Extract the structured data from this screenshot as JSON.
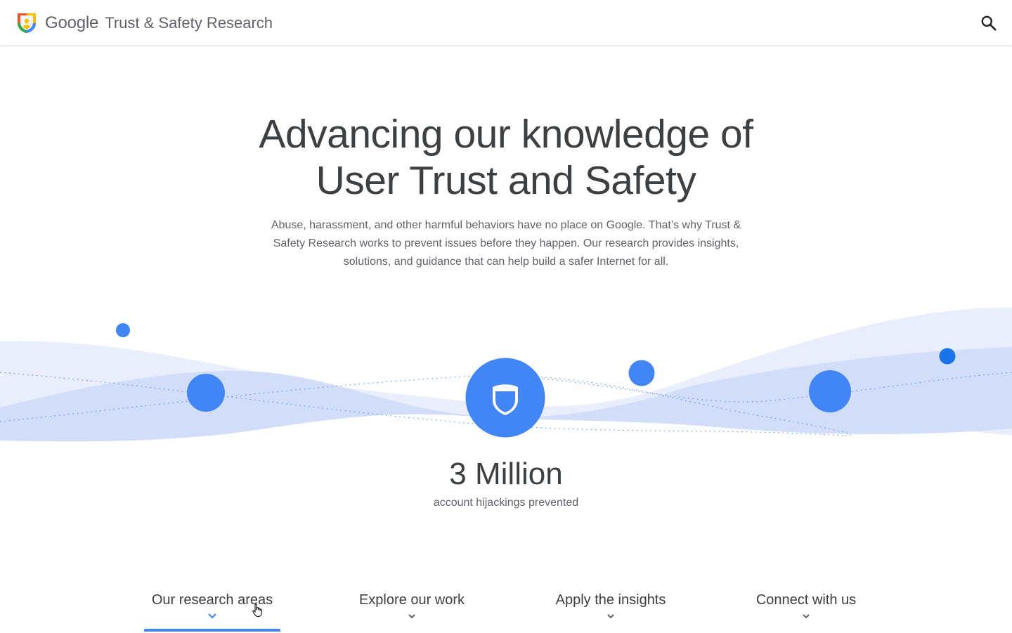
{
  "header": {
    "brand_google": "Google",
    "brand_product": "Trust & Safety Research",
    "logo_icon": "shield-logo-icon",
    "search_icon": "search-icon"
  },
  "hero": {
    "title_line1": "Advancing our knowledge of",
    "title_line2": "User Trust and Safety",
    "description": "Abuse, harassment, and other harmful behaviors have no place on Google. That’s why Trust & Safety Research works to prevent issues before they happen. Our research provides insights, solutions, and guidance that can help build a safer Internet for all."
  },
  "stat": {
    "value": "3 Million",
    "label": "account hijackings prevented",
    "icon": "shield-icon"
  },
  "tabs": [
    {
      "label": "Our research areas",
      "active": true
    },
    {
      "label": "Explore our work",
      "active": false
    },
    {
      "label": "Apply the insights",
      "active": false
    },
    {
      "label": "Connect with us",
      "active": false
    }
  ],
  "colors": {
    "accent": "#4285f4",
    "wave_light": "#e8eefc",
    "wave_mid": "#d2ddfa",
    "text_dark": "#3c4043",
    "text_muted": "#5f6368"
  }
}
